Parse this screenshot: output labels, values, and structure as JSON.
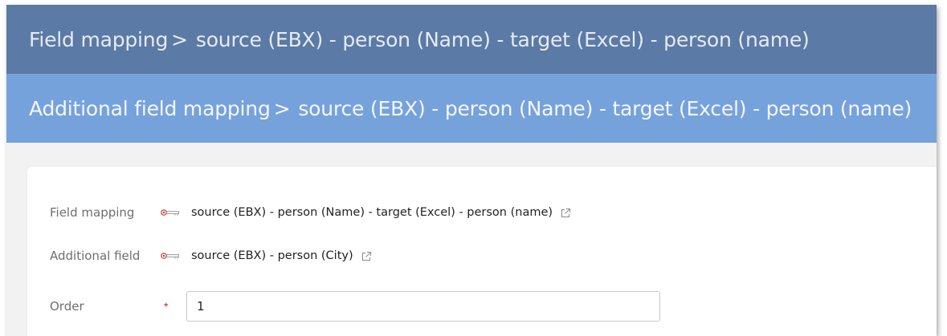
{
  "header": {
    "breadcrumb_label": "Field mapping",
    "breadcrumb_separator": ">",
    "breadcrumb_value": "source (EBX) - person (Name) - target (Excel) - person (name)"
  },
  "subheader": {
    "breadcrumb_label": "Additional field mapping",
    "breadcrumb_separator": ">",
    "breadcrumb_value": "source (EBX) - person (Name) - target (Excel) - person (name)"
  },
  "form": {
    "fields": [
      {
        "label": "Field mapping",
        "value": "source (EBX) - person (Name) - target (Excel) - person (name)"
      },
      {
        "label": "Additional field",
        "value": "source (EBX) - person (City)"
      },
      {
        "label": "Order",
        "value": "1",
        "required_marker": "*"
      }
    ]
  },
  "icons": {
    "key": "key-icon",
    "open_link": "external-link-icon"
  },
  "colors": {
    "header_primary": "#5b7aa5",
    "header_secondary": "#76a2dc",
    "required": "#d0212a"
  }
}
